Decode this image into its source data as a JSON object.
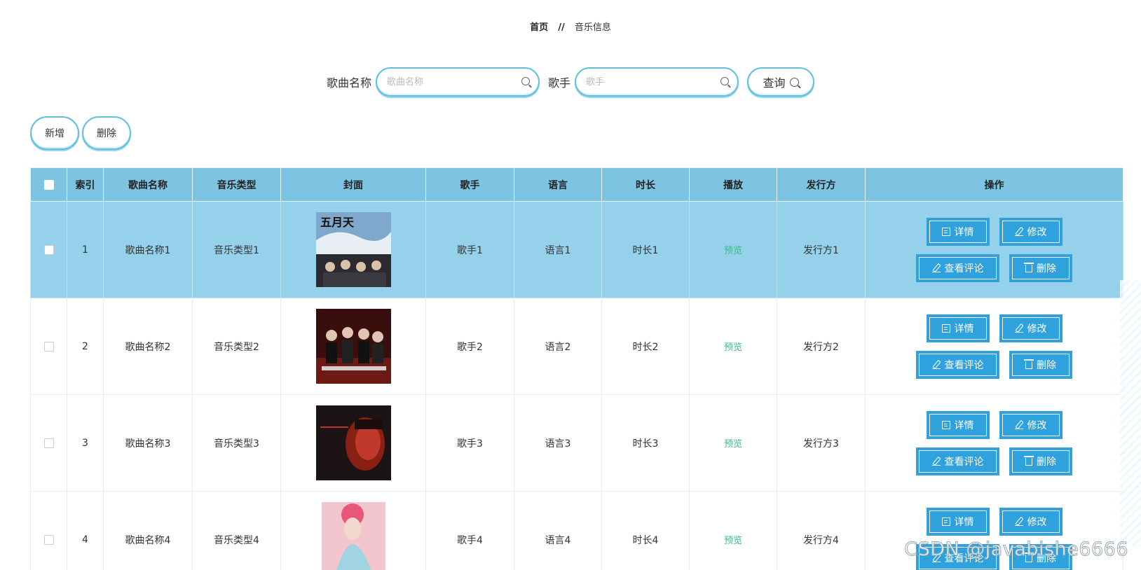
{
  "breadcrumb": {
    "home": "首页",
    "separator": "//",
    "current": "音乐信息"
  },
  "search": {
    "song_label": "歌曲名称",
    "song_placeholder": "歌曲名称",
    "singer_label": "歌手",
    "singer_placeholder": "歌手",
    "query_label": "查询"
  },
  "actions": {
    "add_label": "新增",
    "delete_label": "删除"
  },
  "table": {
    "headers": [
      "索引",
      "歌曲名称",
      "音乐类型",
      "封面",
      "歌手",
      "语言",
      "时长",
      "播放",
      "发行方",
      "操作"
    ],
    "rows": [
      {
        "index": "1",
        "song": "歌曲名称1",
        "type": "音乐类型1",
        "singer": "歌手1",
        "language": "语言1",
        "duration": "时长1",
        "play": "预览",
        "publisher": "发行方1",
        "selected": true
      },
      {
        "index": "2",
        "song": "歌曲名称2",
        "type": "音乐类型2",
        "singer": "歌手2",
        "language": "语言2",
        "duration": "时长2",
        "play": "预览",
        "publisher": "发行方2",
        "selected": false
      },
      {
        "index": "3",
        "song": "歌曲名称3",
        "type": "音乐类型3",
        "singer": "歌手3",
        "language": "语言3",
        "duration": "时长3",
        "play": "预览",
        "publisher": "发行方3",
        "selected": false
      },
      {
        "index": "4",
        "song": "歌曲名称4",
        "type": "音乐类型4",
        "singer": "歌手4",
        "language": "语言4",
        "duration": "时长4",
        "play": "预览",
        "publisher": "发行方4",
        "selected": false
      }
    ],
    "ops": {
      "detail": "详情",
      "edit": "修改",
      "comments": "查看评论",
      "delete": "删除"
    }
  },
  "colors": {
    "header_bg": "#7cc4e2",
    "selected_row_bg": "#95d1ea",
    "button_bg": "#2fa2dd",
    "preview_text": "#3cb88c",
    "pill_border": "#5fbfe0"
  },
  "icons": {
    "detail": "document-icon",
    "edit": "pencil-icon",
    "comments": "pencil-icon",
    "delete": "trash-icon",
    "search": "search-icon"
  },
  "watermark": "CSDN @javabishe6666"
}
